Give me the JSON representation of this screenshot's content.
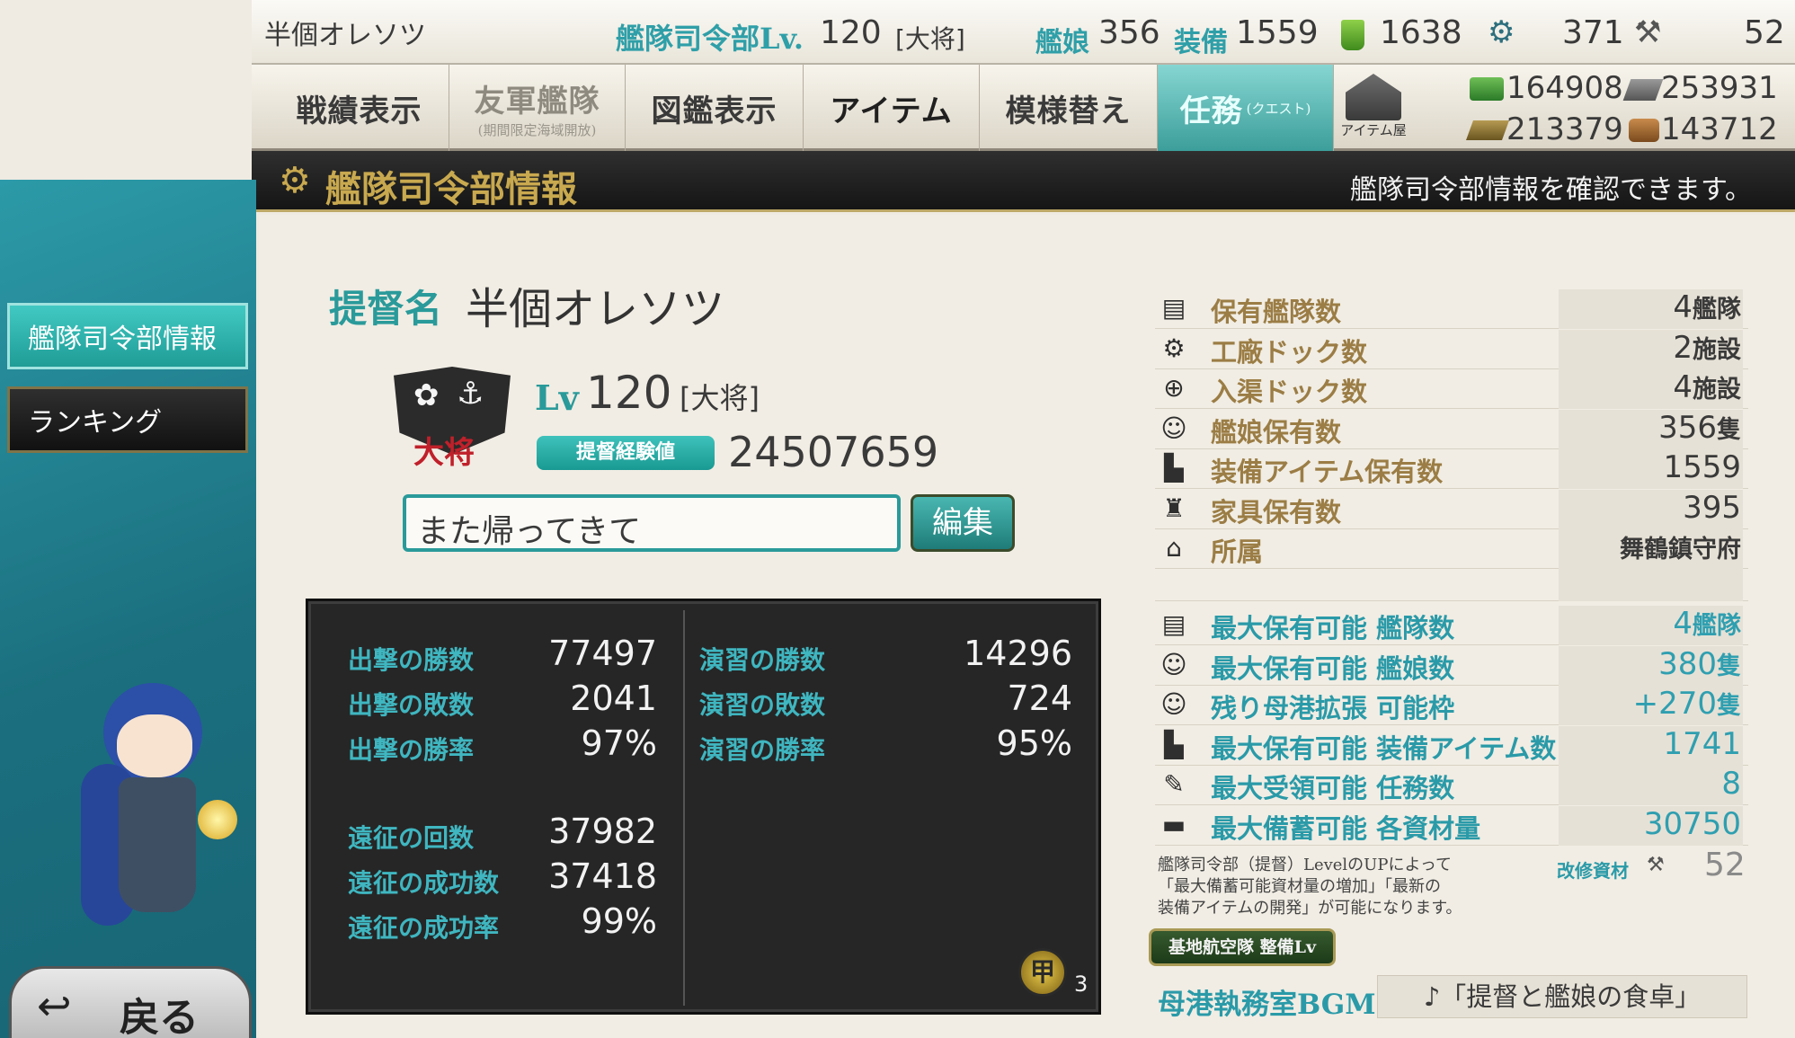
{
  "top": {
    "player_name": "半個オレソツ",
    "hq_level_label": "艦隊司令部Lv.",
    "hq_level": "120",
    "rank": "[大将]",
    "ships_label": "艦娘",
    "ships": "356",
    "equip_label": "装備",
    "equip": "1559",
    "bucket": "1638",
    "devmat": "371",
    "screw": "52",
    "fuel": "164908",
    "ammo": "253931",
    "steel": "213379",
    "bauxite": "143712"
  },
  "menu": {
    "record": "戦績表示",
    "friend_fleet": "友軍艦隊",
    "friend_fleet_sub": "(期間限定海域開放)",
    "album": "図鑑表示",
    "item": "アイテム",
    "furniture": "模様替え",
    "quest": "任務",
    "quest_sub": "(クエスト)",
    "shop": "アイテム屋"
  },
  "titlebar": {
    "title": "艦隊司令部情報",
    "hint": "艦隊司令部情報を確認できます。"
  },
  "sidebar": {
    "hq_info": "艦隊司令部情報",
    "ranking": "ランキング",
    "back": "戻る"
  },
  "profile": {
    "name_label": "提督名",
    "name": "半個オレソツ",
    "rank_badge": "大将",
    "lv_label": "Lv",
    "level": "120",
    "rank": "[大将]",
    "exp_label": "提督経験値",
    "exp": "24507659",
    "comment": "また帰ってきて",
    "edit_button": "編集"
  },
  "stats": {
    "sortie_wins_label": "出撃の勝数",
    "sortie_wins": "77497",
    "sortie_losses_label": "出撃の敗数",
    "sortie_losses": "2041",
    "sortie_rate_label": "出撃の勝率",
    "sortie_rate": "97%",
    "pvp_wins_label": "演習の勝数",
    "pvp_wins": "14296",
    "pvp_losses_label": "演習の敗数",
    "pvp_losses": "724",
    "pvp_rate_label": "演習の勝率",
    "pvp_rate": "95%",
    "exp_count_label": "遠征の回数",
    "exp_count": "37982",
    "exp_success_label": "遠征の成功数",
    "exp_success": "37418",
    "exp_rate_label": "遠征の成功率",
    "exp_rate": "99%",
    "medal_grade": "甲",
    "medal_count": "3"
  },
  "owned": [
    {
      "label": "保有艦隊数",
      "value": "4",
      "unit": "艦隊",
      "icon": "fleet-icon"
    },
    {
      "label": "工廠ドック数",
      "value": "2",
      "unit": "施設",
      "icon": "gear-icon"
    },
    {
      "label": "入渠ドック数",
      "value": "4",
      "unit": "施設",
      "icon": "repair-icon"
    },
    {
      "label": "艦娘保有数",
      "value": "356",
      "unit": "隻",
      "icon": "shipgirl-icon"
    },
    {
      "label": "装備アイテム保有数",
      "value": "1559",
      "unit": "",
      "icon": "equipment-icon"
    },
    {
      "label": "家具保有数",
      "value": "395",
      "unit": "",
      "icon": "furniture-icon"
    },
    {
      "label": "所属",
      "value": "",
      "unit": "舞鶴鎮守府",
      "icon": "base-icon"
    }
  ],
  "capacity": [
    {
      "label": "最大保有可能 艦隊数",
      "value": "4",
      "unit": "艦隊",
      "icon": "fleet-icon"
    },
    {
      "label": "最大保有可能 艦娘数",
      "value": "380",
      "unit": "隻",
      "icon": "shipgirl-icon"
    },
    {
      "label": "残り母港拡張 可能枠",
      "value": "+270",
      "unit": "隻",
      "icon": "port-icon"
    },
    {
      "label": "最大保有可能 装備アイテム数",
      "value": "1741",
      "unit": "",
      "icon": "equipment-icon"
    },
    {
      "label": "最大受領可能 任務数",
      "value": "8",
      "unit": "",
      "icon": "quill-icon"
    },
    {
      "label": "最大備蓄可能 各資材量",
      "value": "30750",
      "unit": "",
      "icon": "book-icon"
    }
  ],
  "notes": {
    "line1": "艦隊司令部（提督）LevelのUPによって",
    "line2": "「最大備蓄可能資材量の増加」「最新の",
    "line3": "装備アイテムの開発」が可能になります。",
    "improve_label": "改修資材",
    "improve_value": "52",
    "base_air_button": "基地航空隊 整備Lv",
    "bgm_label": "母港執務室BGM",
    "bgm_value": "♪「提督と艦娘の食卓」"
  },
  "colors": {
    "teal": "#2a9a9a",
    "gold_label": "#9b7d45",
    "panel_dark": "#262626",
    "cream": "#f1ede4"
  }
}
